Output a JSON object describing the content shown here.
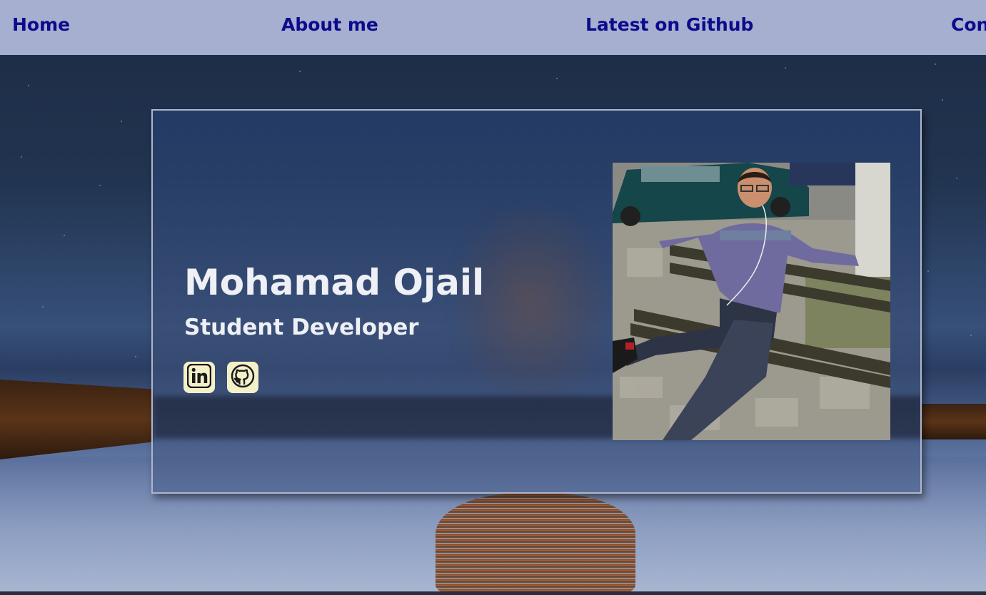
{
  "nav": {
    "items": [
      {
        "label": "Home"
      },
      {
        "label": "About me"
      },
      {
        "label": "Latest on Github"
      },
      {
        "label": "Contact"
      }
    ]
  },
  "profile": {
    "name": "Mohamad Ojail",
    "role": "Student Developer"
  },
  "social": {
    "items": [
      {
        "icon": "linkedin-icon"
      },
      {
        "icon": "github-icon"
      }
    ]
  },
  "colors": {
    "nav_bg": "#a6afcf",
    "nav_link": "#0c0b8c",
    "social_bg": "#f4f0c8",
    "text": "#eef0f5"
  }
}
